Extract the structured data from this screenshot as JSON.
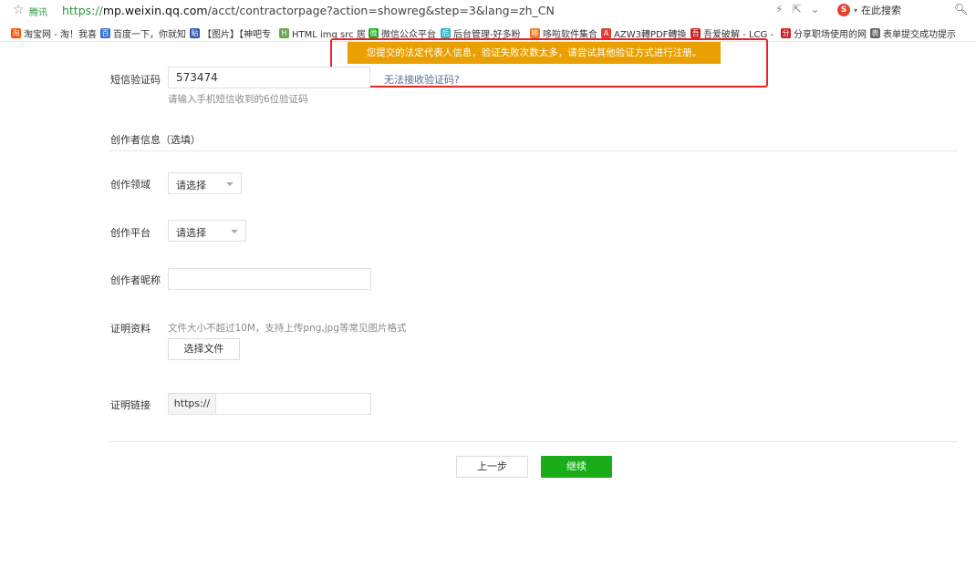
{
  "browser": {
    "site_label": "腾讯",
    "url_scheme": "https://",
    "url_host": "mp.weixin.qq.com",
    "url_path": "/acct/contractorpage?action=showreg&step=3&lang=zh_CN",
    "search_label": "在此搜索",
    "search_engine_icon": "S",
    "bookmarks": [
      {
        "label": "淘宝网 - 淘！我喜",
        "icon_text": "淘",
        "color": "#ff5000"
      },
      {
        "label": "百度一下，你就知",
        "icon_text": "百",
        "color": "#2f6fdb"
      },
      {
        "label": "【图片】【神吧专",
        "icon_text": "贴",
        "color": "#3355aa"
      },
      {
        "label": "HTML img src 居",
        "icon_text": "H",
        "color": "#6aa84f"
      },
      {
        "label": "微信公众平台",
        "icon_text": "微",
        "color": "#1aad19"
      },
      {
        "label": "后台管理-好多粉",
        "icon_text": "后",
        "color": "#2bb5c8"
      },
      {
        "label": "哆啦软件集合",
        "icon_text": "哆",
        "color": "#f07a1a"
      },
      {
        "label": "AZW3轉PDF轉換",
        "icon_text": "A",
        "color": "#e23b2e"
      },
      {
        "label": "吾爱破解 - LCG -",
        "icon_text": "吾",
        "color": "#cc2222"
      },
      {
        "label": "分享职场使用的网",
        "icon_text": "分",
        "color": "#cc2222"
      },
      {
        "label": "表单提交成功提示",
        "icon_text": "表",
        "color": "#666666"
      }
    ]
  },
  "banner": {
    "message": "您提交的法定代表人信息，验证失败次数太多，请尝试其他验证方式进行注册。"
  },
  "form": {
    "sms_label": "短信验证码",
    "sms_value": "573474",
    "sms_hint": "请输入手机短信收到的6位验证码",
    "cannot_receive": "无法接收验证码?",
    "creator_section": "创作者信息（选填）",
    "field_label": "创作领域",
    "field_select": "请选择",
    "platform_label": "创作平台",
    "platform_select": "请选择",
    "nickname_label": "创作者昵称",
    "nickname_value": "",
    "proof_label": "证明资料",
    "proof_hint": "文件大小不超过10M，支持上传png,jpg等常见图片格式",
    "choose_file": "选择文件",
    "link_label": "证明链接",
    "link_prefix": "https://",
    "link_value": "",
    "prev_button": "上一步",
    "next_button": "继续"
  }
}
